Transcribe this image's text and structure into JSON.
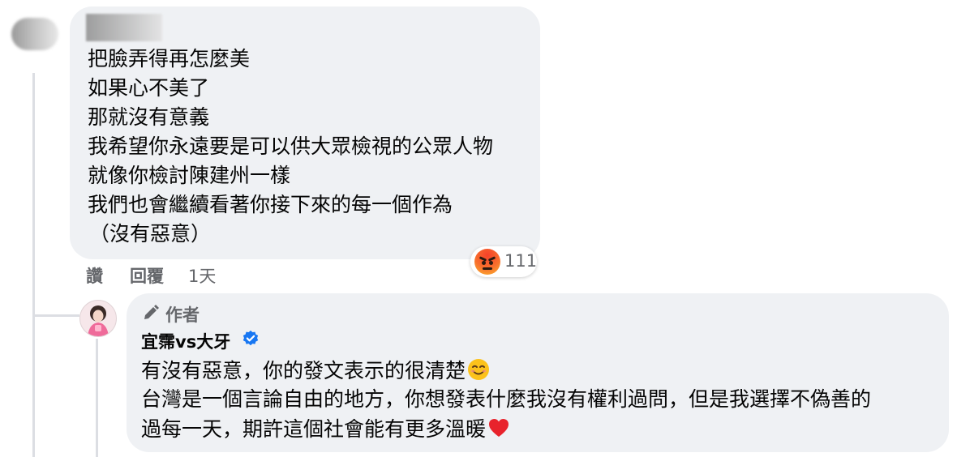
{
  "comment": {
    "lines": [
      "把臉弄得再怎麼美",
      "如果心不美了",
      "那就沒有意義",
      "我希望你永遠要是可以供大眾檢視的公眾人物",
      "就像你檢討陳建州一樣",
      "我們也會繼續看著你接下來的每一個作為",
      "（沒有惡意）"
    ],
    "reaction": {
      "icon": "angry-reaction-icon",
      "count": "111"
    },
    "actions": {
      "like": "讚",
      "reply": "回覆"
    },
    "timestamp": "1天"
  },
  "reply": {
    "badge": "作者",
    "author_name": "宜霈vs大牙",
    "lines": [
      "有沒有惡意，你的發文表示的很清楚",
      "台灣是一個言論自由的地方，你想發表什麼我沒有權利過問，但是我選擇不偽善的",
      "過每一天，期許這個社會能有更多溫暖"
    ],
    "emojis": [
      "smiling-face-icon",
      "red-heart-icon"
    ]
  },
  "colors": {
    "bubble": "#eff1f4",
    "secondary_text": "#65676b",
    "verified": "#1877f2",
    "thread_line": "#dcdee3"
  }
}
